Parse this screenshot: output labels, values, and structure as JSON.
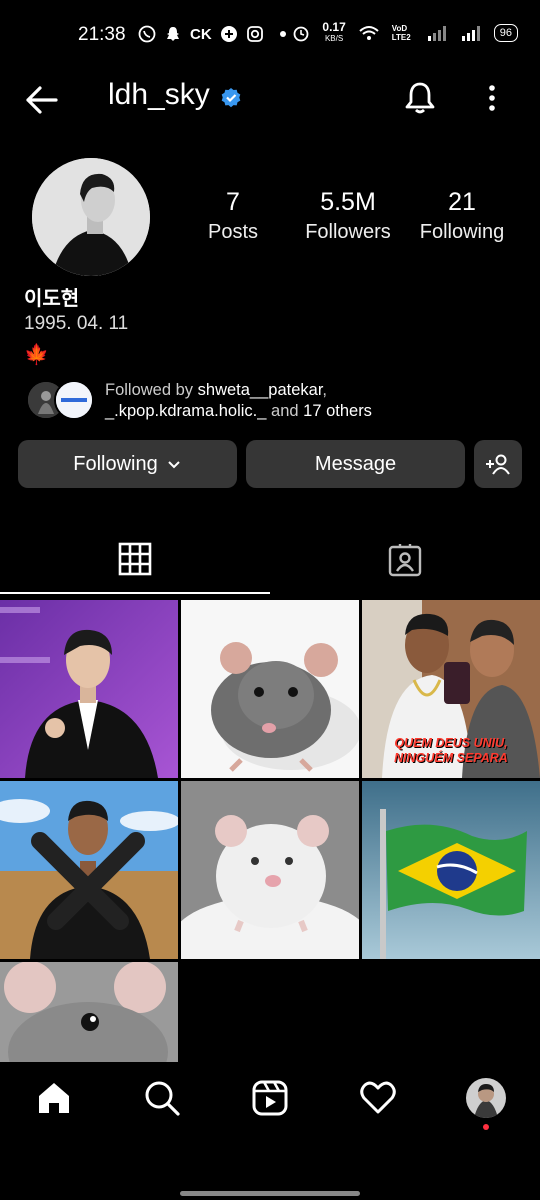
{
  "status_bar": {
    "time": "21:38",
    "left_icons": [
      "whatsapp-icon",
      "snapchat-icon",
      "ck-icon",
      "gallery-icon",
      "instagram-icon",
      "dot-icon"
    ],
    "ck_text": "CK",
    "net_speed": "0.17",
    "net_unit": "KB/S",
    "volte": "VoD LTE2",
    "battery": "96"
  },
  "header": {
    "username": "ldh_sky",
    "verified_color": "#3897f0"
  },
  "profile": {
    "stats": [
      {
        "value": "7",
        "label": "Posts"
      },
      {
        "value": "5.5M",
        "label": "Followers"
      },
      {
        "value": "21",
        "label": "Following"
      }
    ],
    "name": "이도현",
    "bio_line": "1995. 04. 11",
    "bio_emoji": "🍁",
    "followed_by_prefix": "Followed by ",
    "followed_by_user1": "shweta__patekar",
    "followed_by_sep": ",",
    "followed_by_user2": "_.kpop.kdrama.holic._",
    "followed_by_suffix": " and ",
    "followed_by_others": "17 others"
  },
  "actions": {
    "following_label": "Following",
    "message_label": "Message"
  },
  "grid": {
    "posts": [
      {
        "desc": "man in tuxedo making finger heart"
      },
      {
        "desc": "grey rat"
      },
      {
        "desc": "two young men selfie"
      },
      {
        "desc": "man crossing arms with gloves"
      },
      {
        "desc": "white rat"
      },
      {
        "desc": "brazil flag"
      },
      {
        "desc": "rat close-up"
      }
    ],
    "caption_line1": "QUEM DEUS UNIU,",
    "caption_line2": "NINGUÉM SEPARA"
  },
  "colors": {
    "background": "#000000",
    "button_bg": "#363636",
    "accent_blue": "#3897f0",
    "notification_dot": "#ff3040"
  }
}
